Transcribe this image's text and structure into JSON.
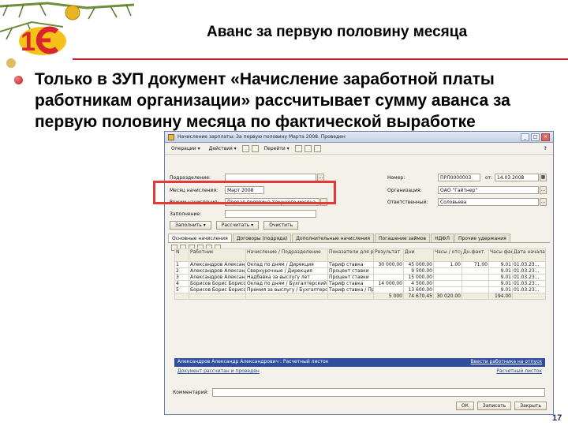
{
  "slide": {
    "title": "Аванс за первую половину месяца",
    "bullet": "Только в ЗУП документ «Начисление заработной платы работникам организации» рассчитывает сумму аванса за первую половину месяца по фактической выработке",
    "page_number": "17"
  },
  "brand": {
    "accent": "#c8202a",
    "logo_red": "#d9262c",
    "logo_yellow": "#f6c21a"
  },
  "window": {
    "title": "Начисление зарплаты: За первую половину Марта 2008. Проведен",
    "buttons": [
      "_",
      "□",
      "×"
    ],
    "toolbar": {
      "ops": "Операции ▾",
      "actions": "Действия ▾",
      "go": "Перейти ▾",
      "help": "?"
    },
    "form": {
      "department_label": "Подразделение:",
      "department_value": "",
      "month_label": "Месяц начисления:",
      "month_value": "Март 2008",
      "mode_label": "Режим начисления:",
      "mode_value": "Первая половина текущего месяца",
      "mode_btn": "...",
      "fill_label": "Заполнение:",
      "fill_value": "",
      "number_label": "Номер:",
      "number_value": "ПРЛ0000003",
      "date_label": "от:",
      "date_value": "14.03.2008",
      "org_label": "Организация:",
      "org_value": "ОАО \"Гайтнер\"",
      "resp_label": "Ответственный:",
      "resp_value": "Соловьева"
    },
    "actions": {
      "fill": "Заполнить ▾",
      "calc": "Рассчитать ▾",
      "clear": "Очистить"
    },
    "tabs": [
      "Основные начисления",
      "Договоры (подряда)",
      "Дополнительные начисления",
      "Погашение займов",
      "НДФЛ",
      "Прочие удержания"
    ],
    "grid": {
      "headers": [
        "N",
        "Работник",
        "Начисление / Подразделение",
        "Показатели для расчета",
        "Результат",
        "Дни",
        "Часы / отсутст.",
        "Дн.факт.",
        "Часы факт.",
        "Дата начала"
      ],
      "rows": [
        [
          "1",
          "Александров Александр",
          "Оклад по дням / Дирекция",
          "Тариф ставка",
          "30 000.00",
          "45 000.00",
          "1.00",
          "71.00",
          "9.01",
          "01.03.23..."
        ],
        [
          "2",
          "Александров Александр",
          "Сверхурочные / Дирекция",
          "Процент ставки",
          "",
          "9 500.00",
          "",
          "",
          "9.01",
          "01.03.23..."
        ],
        [
          "3",
          "Александров Александр",
          "Надбавка за выслугу лет",
          "Процент ставки",
          "",
          "15 000.00",
          "",
          "",
          "9.01",
          "01.03.23..."
        ],
        [
          "4",
          "Борисов Борис Борисович",
          "Оклад по дням / Бухгалтерский отдел",
          "Тариф ставка",
          "14 000.00",
          "4 500.00",
          "",
          "",
          "9.01",
          "01.03.23..."
        ],
        [
          "5",
          "Борисов Борис Борисович",
          "Премия за выслугу / Бухгалтерский отдел",
          "Тариф ставка / Процент",
          "",
          "13 600.00",
          "",
          "",
          "9.01",
          "01.03.23..."
        ]
      ],
      "totals": [
        "",
        "",
        "",
        "",
        "5 000",
        "74 670.45",
        "30 020.00",
        "",
        "194.00",
        ""
      ]
    },
    "status_selected": "Александров Александр Александрович : Расчетный листок",
    "status_right": "Ввести работника на отпуск",
    "link_left": "Документ рассчитан и проведен",
    "link_right": "Расчетный листок",
    "comment_label": "Комментарий:",
    "comment_value": "",
    "bottom_buttons": [
      "ОК",
      "Записать",
      "Закрыть"
    ]
  }
}
